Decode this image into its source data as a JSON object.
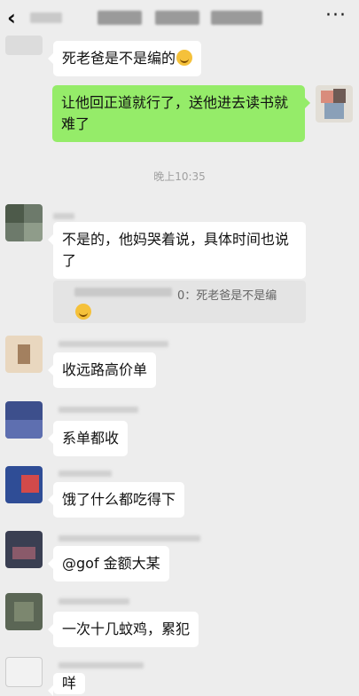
{
  "header": {
    "back_icon": "chevron-left-icon",
    "more_label": "···"
  },
  "timestamp": "晚上10:35",
  "messages": [
    {
      "side": "left",
      "text": "死老爸是不是编的",
      "emoji": "laughing-emoji-icon"
    },
    {
      "side": "right",
      "text": "让他回正道就行了，送他进去读书就难了"
    },
    {
      "side": "left",
      "text": "不是的，他妈哭着说，具体时间也说了"
    },
    {
      "side": "left",
      "text": "收远路高价单"
    },
    {
      "side": "left",
      "text": "系单都收"
    },
    {
      "side": "left",
      "text": "饿了什么都吃得下"
    },
    {
      "side": "left",
      "text": "@gof 金额大某"
    },
    {
      "side": "left",
      "text": "一次十几蚊鸡，累犯"
    },
    {
      "side": "left",
      "text": "咩"
    }
  ],
  "quote": {
    "text": "0：死老爸是不是编"
  }
}
